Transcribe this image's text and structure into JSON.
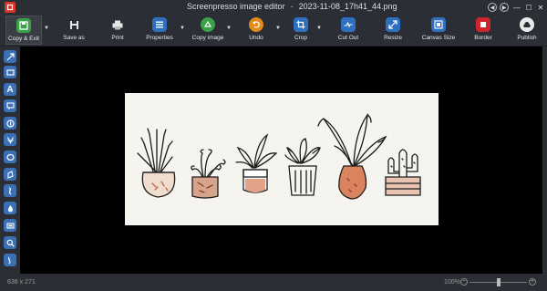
{
  "window": {
    "title": "Screenpresso image editor",
    "filename": "2023-11-08_17h41_44.png"
  },
  "toolbar": {
    "buttons": [
      {
        "label": "Copy & Exit",
        "icon": "copy-exit-icon",
        "color": "#3aa14a"
      },
      {
        "label": "Save as",
        "icon": "save-icon",
        "color": "#2b2e34"
      },
      {
        "label": "Print",
        "icon": "print-icon",
        "color": "#2b2e34"
      },
      {
        "label": "Properties",
        "icon": "properties-icon",
        "color": "#2f6fc0"
      },
      {
        "label": "Copy image",
        "icon": "copy-image-icon",
        "color": "#3aa14a"
      },
      {
        "label": "Undo",
        "icon": "undo-icon",
        "color": "#e08a1a"
      },
      {
        "label": "Crop",
        "icon": "crop-icon",
        "color": "#2f6fc0"
      },
      {
        "label": "Cut Out",
        "icon": "cut-out-icon",
        "color": "#2f6fc0"
      },
      {
        "label": "Resize",
        "icon": "resize-icon",
        "color": "#2f6fc0"
      },
      {
        "label": "Canvas Size",
        "icon": "canvas-size-icon",
        "color": "#2f6fc0"
      },
      {
        "label": "Border",
        "icon": "border-icon",
        "color": "#d0242c"
      },
      {
        "label": "Publish",
        "icon": "publish-icon",
        "color": "#2b2e34"
      }
    ]
  },
  "tools": [
    "arrow-tool-icon",
    "rectangle-tool-icon",
    "text-tool-icon",
    "callout-tool-icon",
    "step-tool-icon",
    "numbered-tool-icon",
    "ellipse-tool-icon",
    "magnifier-tool-icon",
    "highlight-tool-icon",
    "blur-tool-icon",
    "pencil-tool-icon",
    "zoom-tool-icon",
    "more-tools-icon"
  ],
  "status": {
    "dimensions": "638 x 271",
    "zoom": "100%",
    "zoom_level": 0.5
  }
}
